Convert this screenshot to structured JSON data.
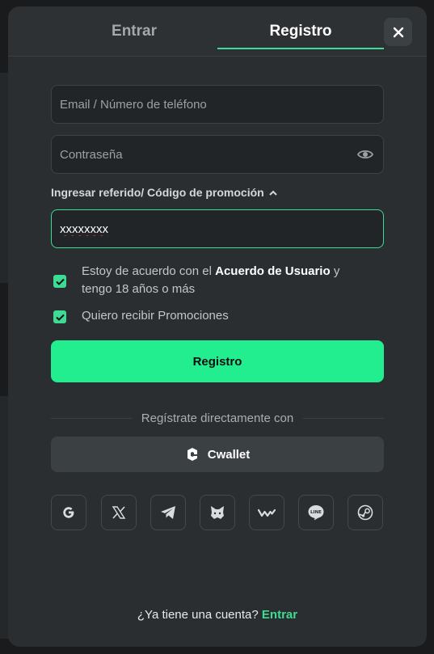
{
  "tabs": {
    "login": "Entrar",
    "register": "Registro"
  },
  "form": {
    "email_placeholder": "Email / Número de teléfono",
    "password_placeholder": "Contraseña",
    "promo_toggle_label": "Ingresar referido/ Código de promoción",
    "promo_value": "xxxxxxxx"
  },
  "agreement": {
    "text_before": "Estoy de acuerdo con el",
    "link": "Acuerdo de Usuario",
    "text_after": "y tengo 18 años o más"
  },
  "promotions_label": "Quiero recibir Promociones",
  "register_button": "Registro",
  "divider_text": "Regístrate directamente con",
  "cwallet_label": "Cwallet",
  "social_icons": [
    "google-icon",
    "x-icon",
    "telegram-icon",
    "metamask-icon",
    "walletconnect-icon",
    "line-icon",
    "steam-icon"
  ],
  "footer": {
    "question": "¿Ya tiene una cuenta?",
    "link": "Entrar"
  },
  "colors": {
    "accent": "#22ee8f",
    "background": "#2a2e30"
  }
}
